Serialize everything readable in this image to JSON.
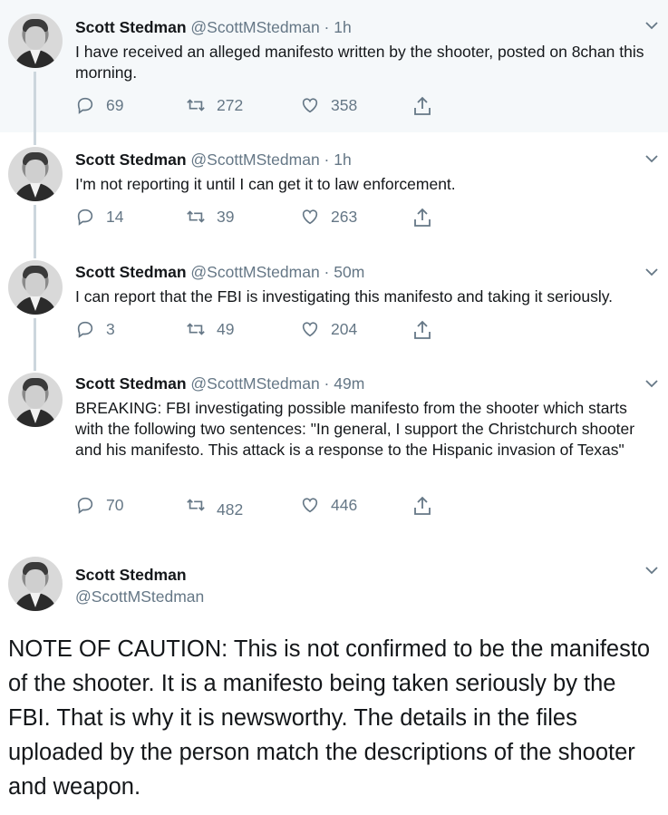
{
  "tweets": [
    {
      "name": "Scott Stedman",
      "handle": "@ScottMStedman",
      "dot": "·",
      "time": "1h",
      "text": "I have received an alleged manifesto written by the shooter, posted on 8chan this morning.",
      "replies": "69",
      "retweets": "272",
      "likes": "358"
    },
    {
      "name": "Scott Stedman",
      "handle": "@ScottMStedman",
      "dot": "·",
      "time": "1h",
      "text": "I'm not reporting it until I can get it to law enforcement.",
      "replies": "14",
      "retweets": "39",
      "likes": "263"
    },
    {
      "name": "Scott Stedman",
      "handle": "@ScottMStedman",
      "dot": "·",
      "time": "50m",
      "text": "I can report that the FBI is investigating this manifesto and taking it seriously.",
      "replies": "3",
      "retweets": "49",
      "likes": "204"
    },
    {
      "name": "Scott Stedman",
      "handle": "@ScottMStedman",
      "dot": "·",
      "time": "49m",
      "text": "BREAKING: FBI investigating possible manifesto from the shooter which starts with the following two sentences: \"In general, I support the Christchurch shooter and his manifesto. This attack is a response to the Hispanic invasion of Texas\"",
      "replies": "70",
      "retweets": "482",
      "likes": "446"
    }
  ],
  "main_tweet": {
    "name": "Scott Stedman",
    "handle": "@ScottMStedman",
    "text": "NOTE OF CAUTION: This is not confirmed to be the manifesto of the shooter. It is a manifesto being taken seriously by the FBI. That is why it is newsworthy. The details in the files uploaded by the person match the descriptions of the shooter and weapon."
  },
  "icons": [
    "reply-icon",
    "retweet-icon",
    "like-icon",
    "share-icon",
    "chevron-down-icon"
  ],
  "colors": {
    "text": "#14171a",
    "secondary": "#657786",
    "thread_line": "#ccd6dd",
    "highlight_bg": "#f5f8fa"
  }
}
